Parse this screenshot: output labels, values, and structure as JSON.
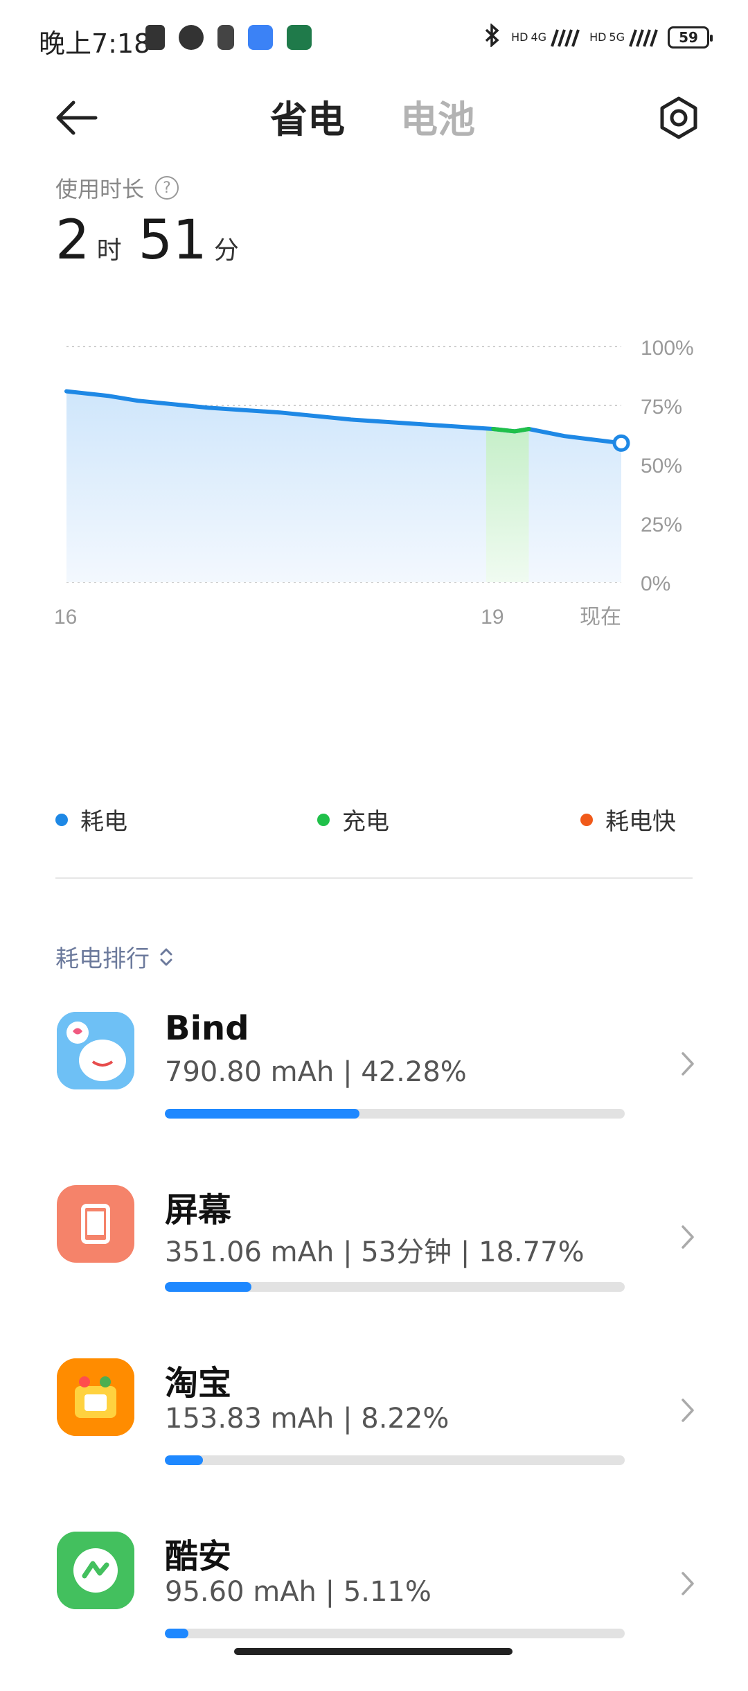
{
  "status_bar": {
    "time": "晚上7:18",
    "net1": "4G",
    "net2": "5G",
    "battery": "59"
  },
  "header": {
    "tab_active": "省电",
    "tab_inactive": "电池"
  },
  "usage": {
    "label": "使用时长",
    "hours": "2",
    "hours_unit": "时",
    "minutes": "51",
    "minutes_unit": "分"
  },
  "chart_data": {
    "type": "area",
    "y_ticks": [
      "100%",
      "75%",
      "50%",
      "25%",
      "0%"
    ],
    "x_ticks": [
      "16",
      "19",
      "现在"
    ],
    "ylim": [
      0,
      100
    ],
    "series": [
      {
        "name": "耗电",
        "color": "#1e88e5",
        "x": [
          16.0,
          16.3,
          16.5,
          17.0,
          17.5,
          18.0,
          18.5,
          19.0,
          19.15,
          19.25,
          19.5,
          19.9
        ],
        "values": [
          81,
          79,
          77,
          74,
          72,
          69,
          67,
          65,
          64,
          65,
          62,
          59
        ]
      }
    ],
    "charging_range": [
      18.95,
      19.25
    ],
    "grid": true
  },
  "legend": {
    "items": [
      {
        "label": "耗电",
        "color": "#1e88e5"
      },
      {
        "label": "充电",
        "color": "#20c04a"
      },
      {
        "label": "耗电快",
        "color": "#f05a1a"
      }
    ]
  },
  "rank": {
    "label": "耗电排行"
  },
  "apps": [
    {
      "name": "Bind",
      "stats": "790.80 mAh | 42.28%",
      "progress": 0.4228,
      "icon": "bind-app-icon"
    },
    {
      "name": "屏幕",
      "stats": "351.06 mAh | 53分钟 | 18.77%",
      "progress": 0.1877,
      "icon": "screen-icon"
    },
    {
      "name": "淘宝",
      "stats": "153.83 mAh | 8.22%",
      "progress": 0.0822,
      "icon": "taobao-app-icon"
    },
    {
      "name": "酷安",
      "stats": "95.60 mAh | 5.11%",
      "progress": 0.0511,
      "icon": "coolapk-app-icon"
    }
  ]
}
